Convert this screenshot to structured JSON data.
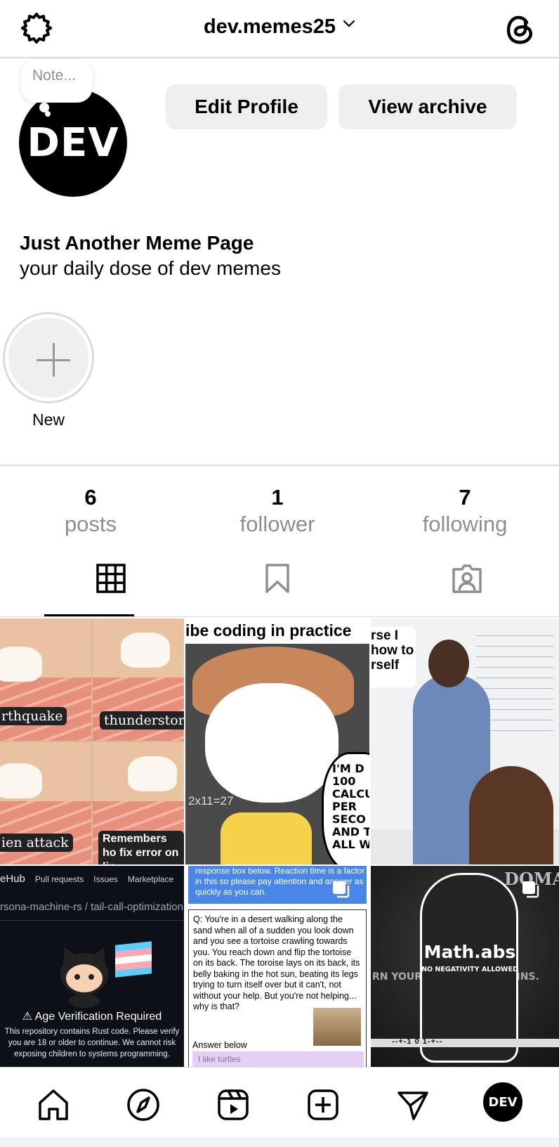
{
  "header": {
    "username": "dev.memes25",
    "settings_icon": "settings-icon",
    "threads_icon": "threads-icon"
  },
  "profile": {
    "avatar_text": "DEV",
    "note_placeholder": "Note...",
    "edit_profile_label": "Edit Profile",
    "view_archive_label": "View archive",
    "bio_name": "Just Another Meme Page",
    "bio_text": "your daily dose of dev memes"
  },
  "highlights": {
    "new_label": "New"
  },
  "stats": {
    "posts_count": "6",
    "posts_label": "posts",
    "followers_count": "1",
    "followers_label": "follower",
    "following_count": "7",
    "following_label": "following"
  },
  "tabs": {
    "active": "grid",
    "items": [
      "grid-icon",
      "saved-icon",
      "tagged-icon"
    ]
  },
  "posts": [
    {
      "captions": [
        "rthquake",
        "thunderstor",
        "ien attack",
        "Remembers ho fix error on lin"
      ]
    },
    {
      "title": "ibe coding in practice",
      "bubble": "I'M D 100 CALCUL PER SECO AND T ALL WRO",
      "board": "2x11=27"
    },
    {
      "caption": "rse I how to rself"
    },
    {
      "nav_brand": "eHub",
      "nav_items": [
        "Pull requests",
        "Issues",
        "Marketplace"
      ],
      "path": "rsona-machine-rs / tail-call-optimization",
      "warning_title": "Age Verification Required",
      "warning_text": "This repository contains Rust code. Please verify you are 18 or older to continue. We cannot risk exposing children to systems programming."
    },
    {
      "top_text": "response box below. Reaction time is a factor in this so please pay attention and answer as quickly as you can.",
      "question": "Q: You're in a desert walking along the sand when all of a sudden you look down and you see a tortoise crawling towards you. You reach down and flip the tortoise on its back. The toroise lays on its back, its belly baking in the hot sun, beating its legs trying to turn itself over but it can't, not without your help. But you're not helping... why is that?",
      "answer_label": "Answer below",
      "answer_value": "I like turtles"
    },
    {
      "label": "Math.abs",
      "sublabel": "NO NEGATIVITY ALLOWED",
      "top_right": "DOMA",
      "side_text": "RN YOUR EGATIVES TO GAINS.",
      "bar_text": "--+-1 0 1-+--"
    }
  ],
  "bottom_nav": {
    "avatar_text": "DEV",
    "items": [
      "home-icon",
      "explore-icon",
      "reels-icon",
      "create-icon",
      "messages-icon",
      "profile-avatar"
    ]
  }
}
